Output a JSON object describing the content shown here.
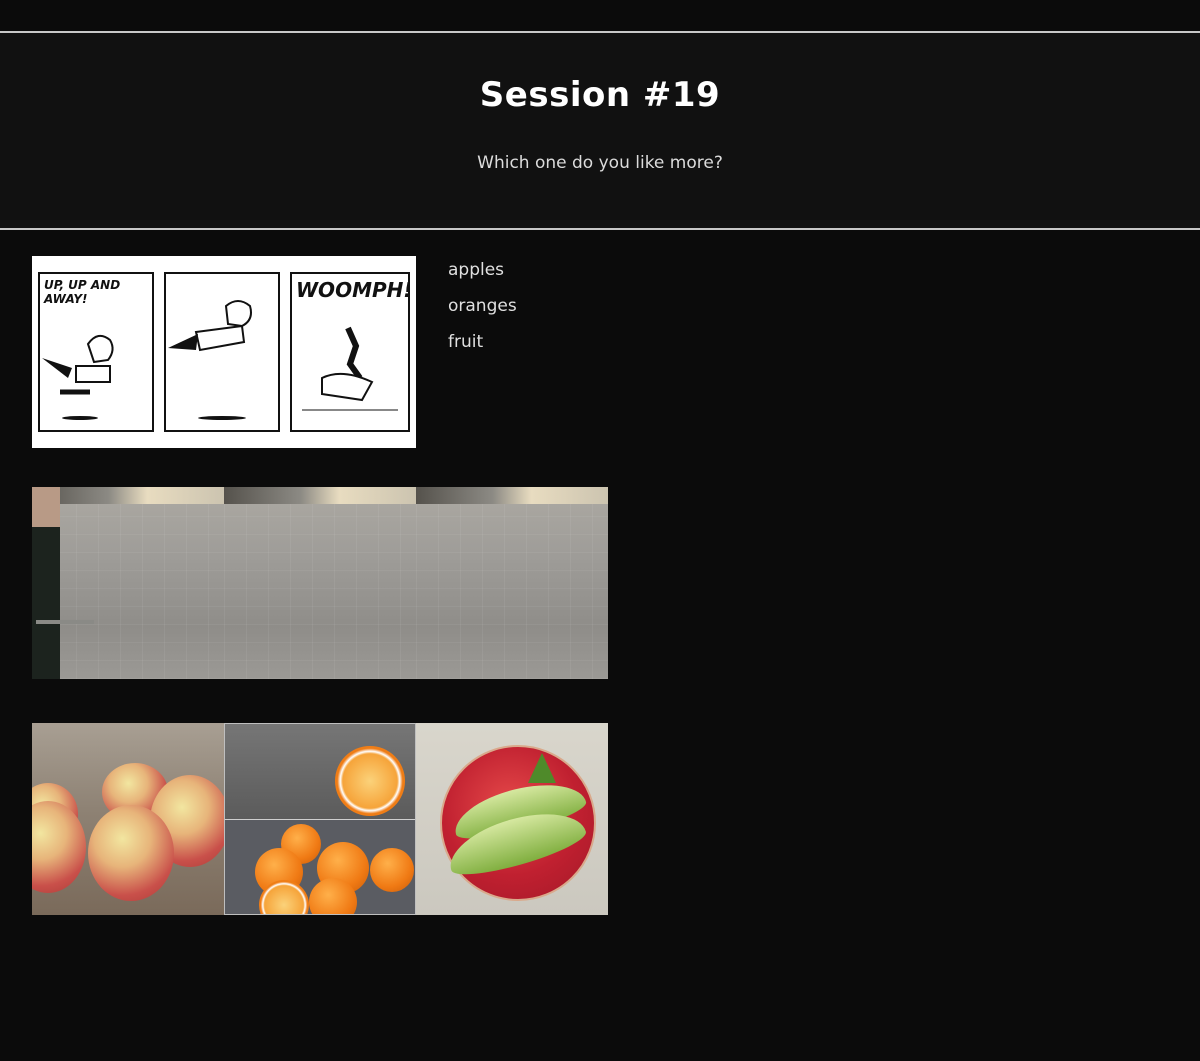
{
  "header": {
    "title": "Session #19",
    "question": "Which one do you like more?"
  },
  "comic": {
    "panel1_caption": "UP, UP AND AWAY!",
    "panel3_caption": "WOOMPH!"
  },
  "options": [
    {
      "label": "apples"
    },
    {
      "label": "oranges"
    },
    {
      "label": "fruit"
    }
  ],
  "images": {
    "strip2": [
      "curtain-frame-1",
      "curtain-frame-2",
      "curtain-frame-3"
    ],
    "strip3": [
      "apples-photo",
      "oranges-photo",
      "fruit-bowl-photo"
    ]
  },
  "colors": {
    "background": "#0b0b0b",
    "header_background": "#111111",
    "divider": "#c8c8c8",
    "text": "#e6e6e6"
  }
}
